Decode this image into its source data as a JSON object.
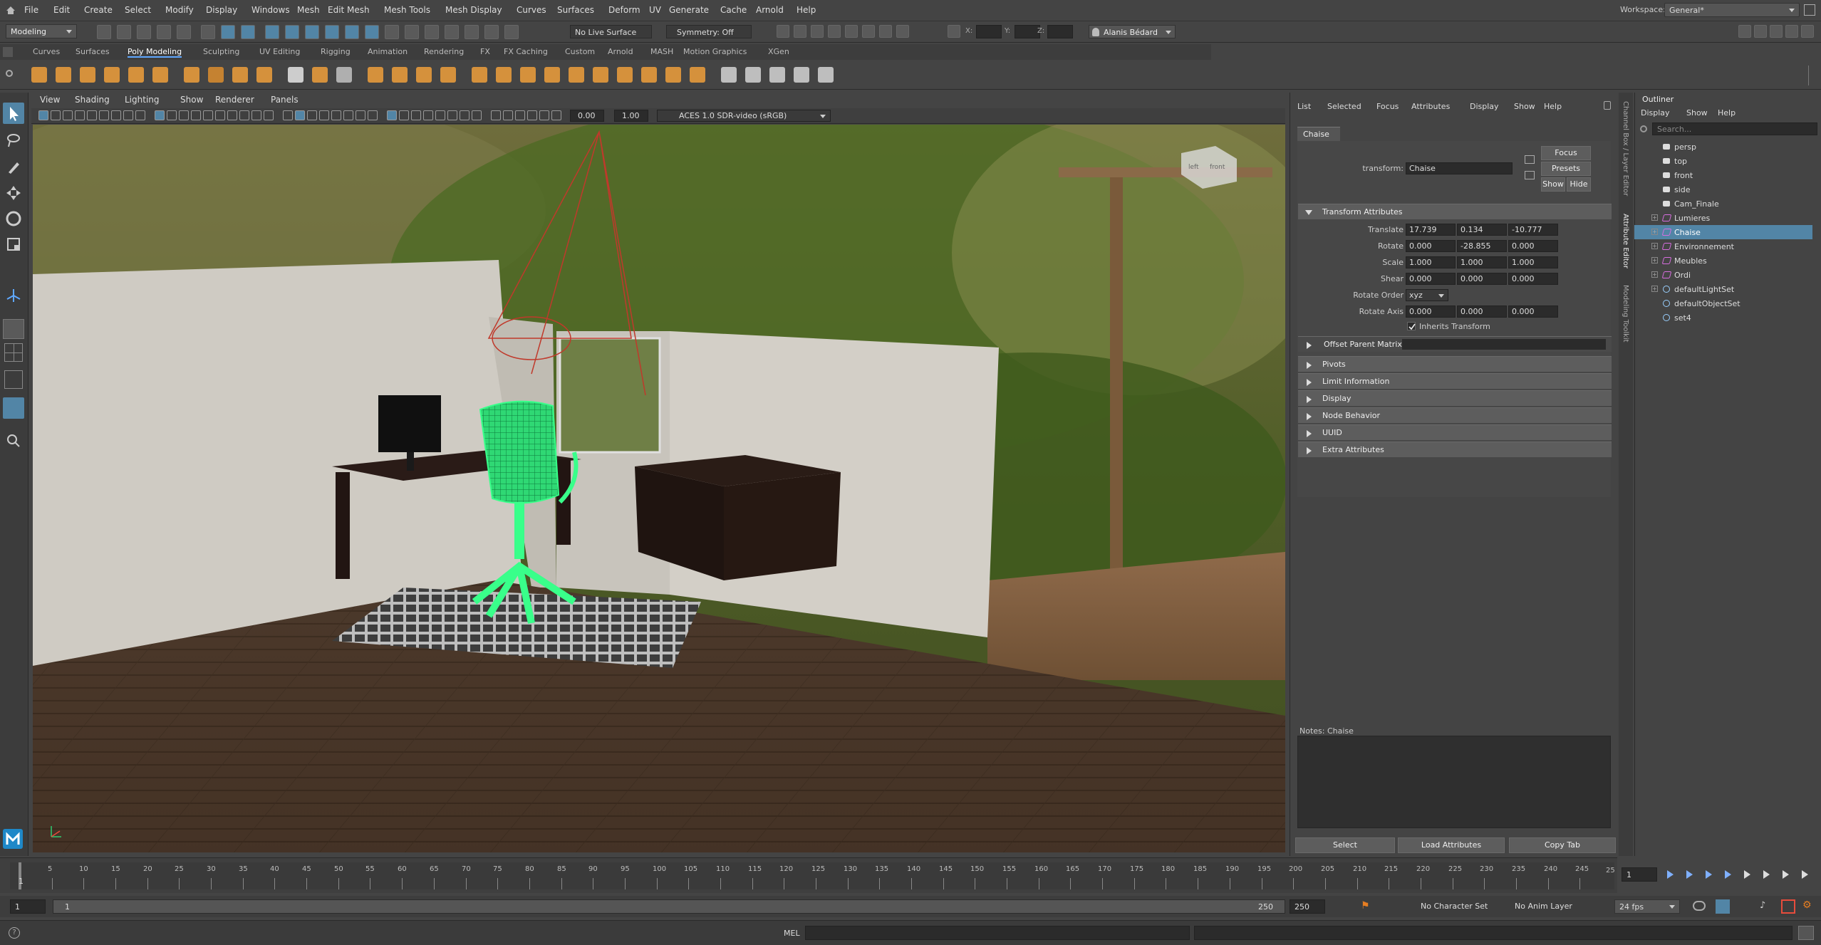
{
  "menubar": {
    "items": [
      "File",
      "Edit",
      "Create",
      "Select",
      "Modify",
      "Display",
      "Windows",
      "Mesh",
      "Edit Mesh",
      "Mesh Tools",
      "Mesh Display",
      "Curves",
      "Surfaces",
      "Deform",
      "UV",
      "Generate",
      "Cache",
      "Arnold",
      "Help"
    ],
    "workspace_label": "Workspace:",
    "workspace_value": "General*"
  },
  "statusline": {
    "mode": "Modeling",
    "live_surface": "No Live Surface",
    "symmetry": "Symmetry: Off",
    "x_label": "X:",
    "y_label": "Y:",
    "z_label": "Z:",
    "user": "Alanis Bédard"
  },
  "shelf_tabs": [
    "Curves",
    "Surfaces",
    "Poly Modeling",
    "Sculpting",
    "UV Editing",
    "Rigging",
    "Animation",
    "Rendering",
    "FX",
    "FX Caching",
    "Custom",
    "Arnold",
    "MASH",
    "Motion Graphics",
    "XGen"
  ],
  "shelf_active": "Poly Modeling",
  "viewport": {
    "menus": [
      "View",
      "Shading",
      "Lighting",
      "Show",
      "Renderer",
      "Panels"
    ],
    "exposure": "0.00",
    "gamma": "1.00",
    "color_space": "ACES 1.0 SDR-video (sRGB)",
    "cube_left": "left",
    "cube_front": "front"
  },
  "attribute_editor": {
    "menus": [
      "List",
      "Selected",
      "Focus",
      "Attributes",
      "Display",
      "Show",
      "Help"
    ],
    "tab": "Chaise",
    "transform_label": "transform:",
    "transform_value": "Chaise",
    "focus_btn": "Focus",
    "presets_btn": "Presets",
    "show_btn": "Show",
    "hide_btn": "Hide",
    "section_transform": "Transform Attributes",
    "translate_label": "Translate",
    "translate": [
      "17.739",
      "0.134",
      "-10.777"
    ],
    "rotate_label": "Rotate",
    "rotate": [
      "0.000",
      "-28.855",
      "0.000"
    ],
    "scale_label": "Scale",
    "scale": [
      "1.000",
      "1.000",
      "1.000"
    ],
    "shear_label": "Shear",
    "shear": [
      "0.000",
      "0.000",
      "0.000"
    ],
    "rotate_order_label": "Rotate Order",
    "rotate_order": "xyz",
    "rotate_axis_label": "Rotate Axis",
    "rotate_axis": [
      "0.000",
      "0.000",
      "0.000"
    ],
    "inherits_transform": "Inherits Transform",
    "offset_parent_matrix": "Offset Parent Matrix",
    "sections": [
      "Pivots",
      "Limit Information",
      "Display",
      "Node Behavior",
      "UUID",
      "Extra Attributes"
    ],
    "notes_label": "Notes:  Chaise",
    "bottom_buttons": [
      "Select",
      "Load Attributes",
      "Copy Tab"
    ],
    "side_tabs": [
      "Channel Box / Layer Editor",
      "Attribute Editor",
      "Modeling Toolkit"
    ]
  },
  "outliner": {
    "title": "Outliner",
    "menus": [
      "Display",
      "Show",
      "Help"
    ],
    "search_placeholder": "Search...",
    "items": [
      {
        "label": "persp",
        "type": "camera",
        "expand": false,
        "selected": false
      },
      {
        "label": "top",
        "type": "camera",
        "expand": false,
        "selected": false
      },
      {
        "label": "front",
        "type": "camera",
        "expand": false,
        "selected": false
      },
      {
        "label": "side",
        "type": "camera",
        "expand": false,
        "selected": false
      },
      {
        "label": "Cam_Finale",
        "type": "camera",
        "expand": false,
        "selected": false
      },
      {
        "label": "Lumieres",
        "type": "group",
        "expand": true,
        "selected": false
      },
      {
        "label": "Chaise",
        "type": "group",
        "expand": true,
        "selected": true
      },
      {
        "label": "Environnement",
        "type": "group",
        "expand": true,
        "selected": false
      },
      {
        "label": "Meubles",
        "type": "group",
        "expand": true,
        "selected": false
      },
      {
        "label": "Ordi",
        "type": "group",
        "expand": true,
        "selected": false
      },
      {
        "label": "defaultLightSet",
        "type": "set",
        "expand": true,
        "selected": false
      },
      {
        "label": "defaultObjectSet",
        "type": "set",
        "expand": false,
        "selected": false
      },
      {
        "label": "set4",
        "type": "set",
        "expand": false,
        "selected": false
      }
    ]
  },
  "timeline": {
    "ticks": [
      "5",
      "10",
      "15",
      "20",
      "25",
      "30",
      "35",
      "40",
      "45",
      "50",
      "55",
      "60",
      "65",
      "70",
      "75",
      "80",
      "85",
      "90",
      "95",
      "100",
      "105",
      "110",
      "115",
      "120",
      "125",
      "130",
      "135",
      "140",
      "145",
      "150",
      "155",
      "160",
      "165",
      "170",
      "175",
      "180",
      "185",
      "190",
      "195",
      "200",
      "205",
      "210",
      "215",
      "220",
      "225",
      "230",
      "235",
      "240",
      "245"
    ],
    "first_tick": "1",
    "last_tick": "25",
    "current_frame": "1"
  },
  "range": {
    "start": "1",
    "range_start": "1",
    "range_end": "250",
    "end": "250",
    "character_set": "No Character Set",
    "anim_layer": "No Anim Layer",
    "fps": "24 fps"
  },
  "cmdline": {
    "label": "MEL"
  },
  "colors": {
    "selection": "#5285a6",
    "wire": "#39ff8a",
    "panel": "#444444"
  }
}
